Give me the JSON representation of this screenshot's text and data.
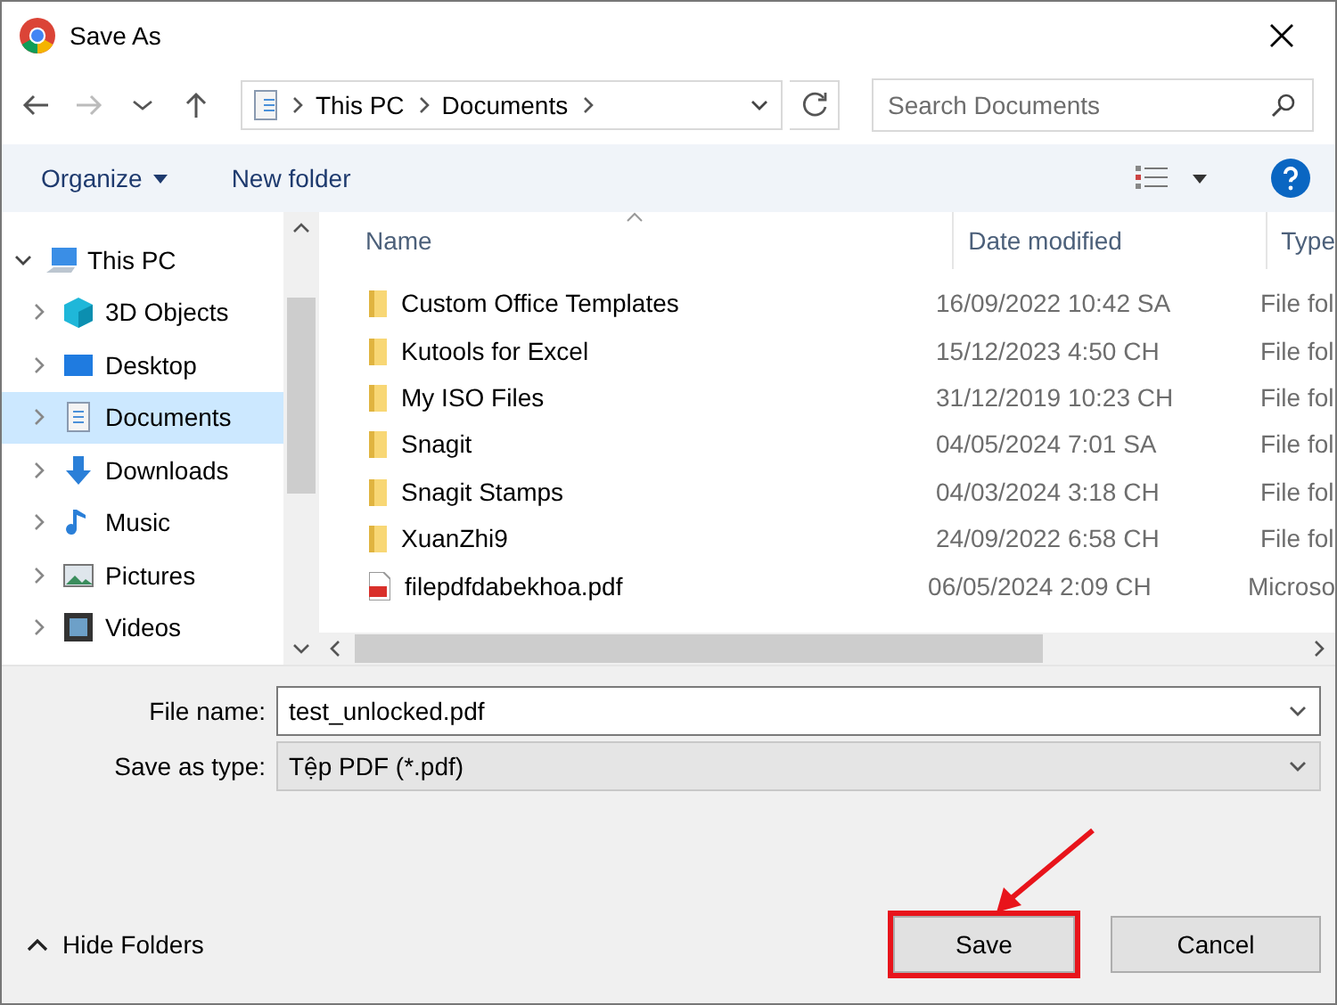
{
  "window": {
    "title": "Save As"
  },
  "address": {
    "segments": [
      "This PC",
      "Documents"
    ]
  },
  "search": {
    "placeholder": "Search Documents"
  },
  "toolbar": {
    "organize": "Organize",
    "new_folder": "New folder"
  },
  "sidebar": {
    "items": [
      {
        "label": "This PC",
        "kind": "pc",
        "expanded": true,
        "selected": false,
        "children": [
          {
            "label": "3D Objects",
            "kind": "cube",
            "selected": false
          },
          {
            "label": "Desktop",
            "kind": "desktop",
            "selected": false
          },
          {
            "label": "Documents",
            "kind": "doc",
            "selected": true
          },
          {
            "label": "Downloads",
            "kind": "download",
            "selected": false
          },
          {
            "label": "Music",
            "kind": "music",
            "selected": false
          },
          {
            "label": "Pictures",
            "kind": "picture",
            "selected": false
          },
          {
            "label": "Videos",
            "kind": "video",
            "selected": false
          }
        ]
      }
    ]
  },
  "table": {
    "columns": [
      "Name",
      "Date modified",
      "Type"
    ],
    "rows": [
      {
        "kind": "folder",
        "name": "Custom Office Templates",
        "date": "16/09/2022 10:42 SA",
        "type": "File fol"
      },
      {
        "kind": "folder",
        "name": "Kutools for Excel",
        "date": "15/12/2023 4:50 CH",
        "type": "File fol"
      },
      {
        "kind": "folder",
        "name": "My ISO Files",
        "date": "31/12/2019 10:23 CH",
        "type": "File fol"
      },
      {
        "kind": "folder",
        "name": "Snagit",
        "date": "04/05/2024 7:01 SA",
        "type": "File fol"
      },
      {
        "kind": "folder",
        "name": "Snagit Stamps",
        "date": "04/03/2024 3:18 CH",
        "type": "File fol"
      },
      {
        "kind": "folder",
        "name": "XuanZhi9",
        "date": "24/09/2022 6:58 CH",
        "type": "File fol"
      },
      {
        "kind": "pdf",
        "name": "filepdfdabekhoa.pdf",
        "date": "06/05/2024 2:09 CH",
        "type": "Microso"
      }
    ]
  },
  "form": {
    "file_name_label": "File name:",
    "file_name": "test_unlocked.pdf",
    "type_label": "Save as type:",
    "type_value": "Tệp PDF (*.pdf)"
  },
  "footer": {
    "hide_folders": "Hide Folders",
    "buttons": [
      {
        "label": "Save",
        "highlighted": true
      },
      {
        "label": "Cancel",
        "highlighted": false
      }
    ]
  }
}
